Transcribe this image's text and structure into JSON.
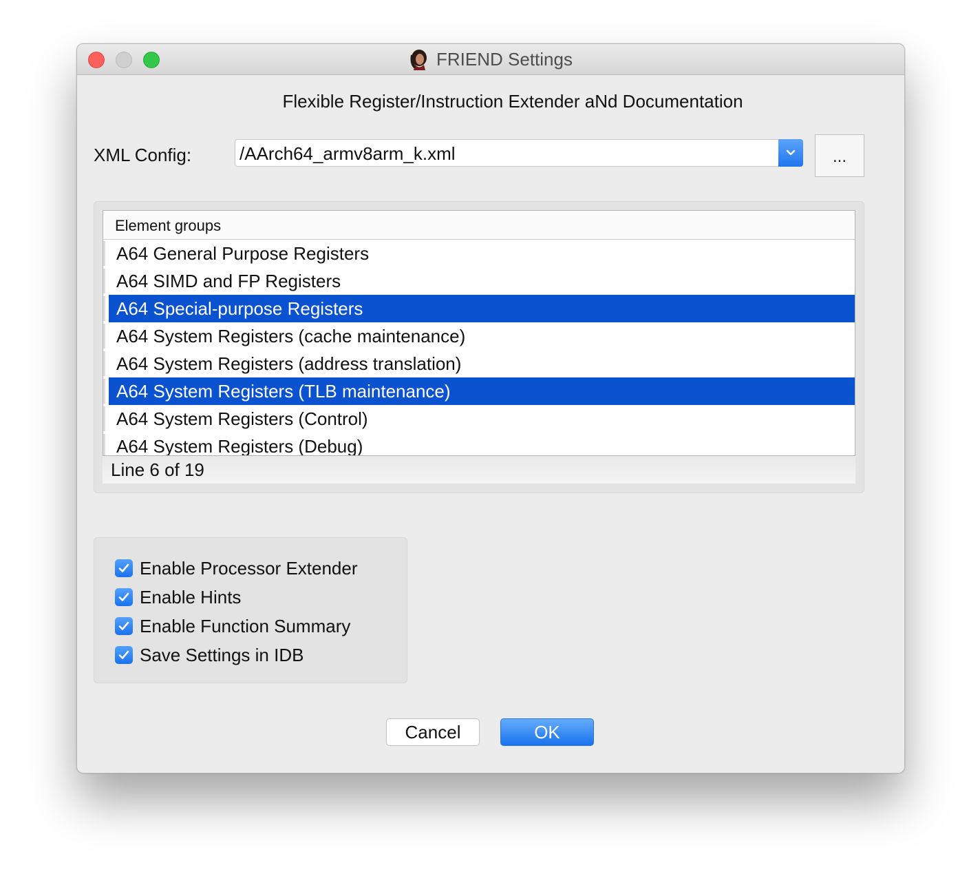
{
  "window": {
    "title": "FRIEND Settings",
    "subtitle": "Flexible Register/Instruction Extender aNd Documentation"
  },
  "config": {
    "label": "XML Config:",
    "value": "/AArch64_armv8arm_k.xml",
    "browse_label": "..."
  },
  "groups": {
    "header": "Element groups",
    "rows": [
      {
        "label": "A64 General Purpose Registers",
        "selected": false
      },
      {
        "label": "A64 SIMD and FP Registers",
        "selected": false
      },
      {
        "label": "A64 Special-purpose Registers",
        "selected": true
      },
      {
        "label": "A64 System Registers (cache maintenance)",
        "selected": false
      },
      {
        "label": "A64 System Registers (address translation)",
        "selected": false
      },
      {
        "label": "A64 System Registers (TLB maintenance)",
        "selected": true
      },
      {
        "label": "A64 System Registers (Control)",
        "selected": false
      },
      {
        "label": "A64 System Registers (Debug)",
        "selected": false
      }
    ],
    "status": "Line 6 of 19"
  },
  "options": [
    {
      "label": "Enable Processor Extender",
      "checked": true
    },
    {
      "label": "Enable Hints",
      "checked": true
    },
    {
      "label": "Enable Function Summary",
      "checked": true
    },
    {
      "label": "Save Settings in IDB",
      "checked": true
    }
  ],
  "buttons": {
    "cancel": "Cancel",
    "ok": "OK"
  },
  "colors": {
    "selection": "#0b52d1",
    "accent": "#1a73ec",
    "close": "#fc605c",
    "maximize": "#34c84a"
  }
}
